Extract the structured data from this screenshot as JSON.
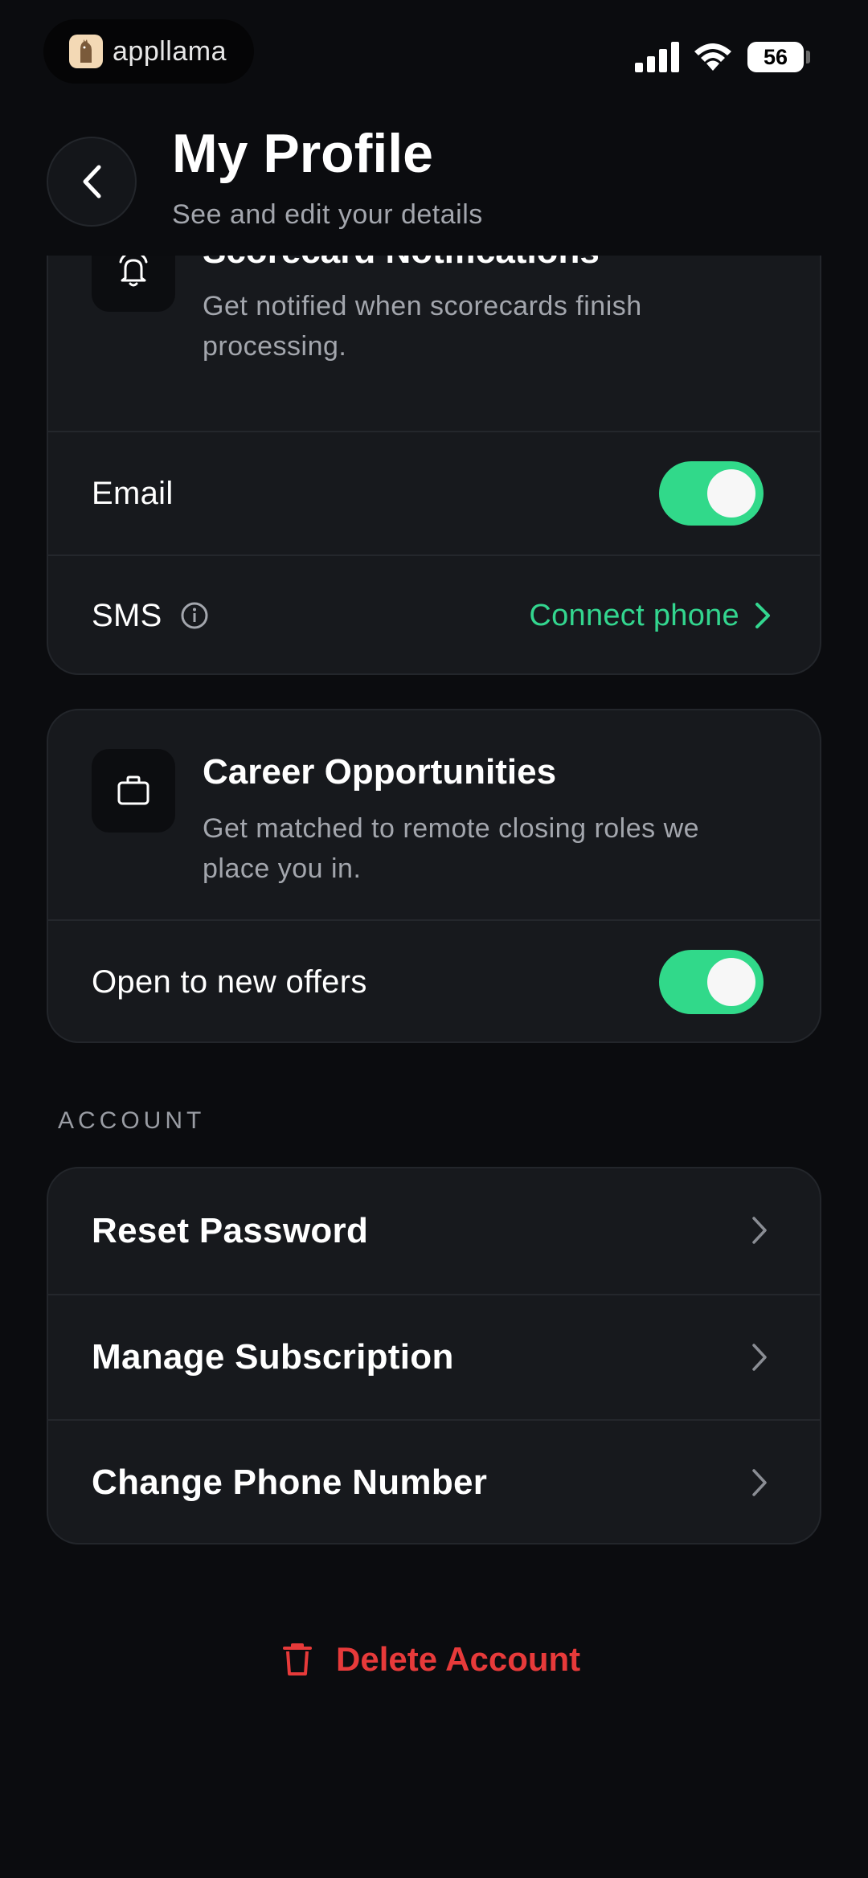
{
  "status_bar": {
    "app_name": "appllama",
    "battery": "56"
  },
  "header": {
    "title": "My Profile",
    "subtitle": "See and edit your details"
  },
  "scorecard": {
    "title": "Scorecard Notifications",
    "description": "Get notified when scorecards finish processing.",
    "email_label": "Email",
    "email_enabled": true,
    "sms_label": "SMS",
    "connect_phone": "Connect phone"
  },
  "career": {
    "title": "Career Opportunities",
    "description": "Get matched to remote closing roles we place you in.",
    "offers_label": "Open to new offers",
    "offers_enabled": true
  },
  "account": {
    "section_label": "ACCOUNT",
    "items": [
      {
        "label": "Reset Password"
      },
      {
        "label": "Manage Subscription"
      },
      {
        "label": "Change Phone Number"
      }
    ]
  },
  "delete_account": "Delete Account",
  "colors": {
    "accent_green": "#31d98a",
    "danger_red": "#e73a3a",
    "background": "#0b0c0f",
    "card": "#17191d"
  }
}
